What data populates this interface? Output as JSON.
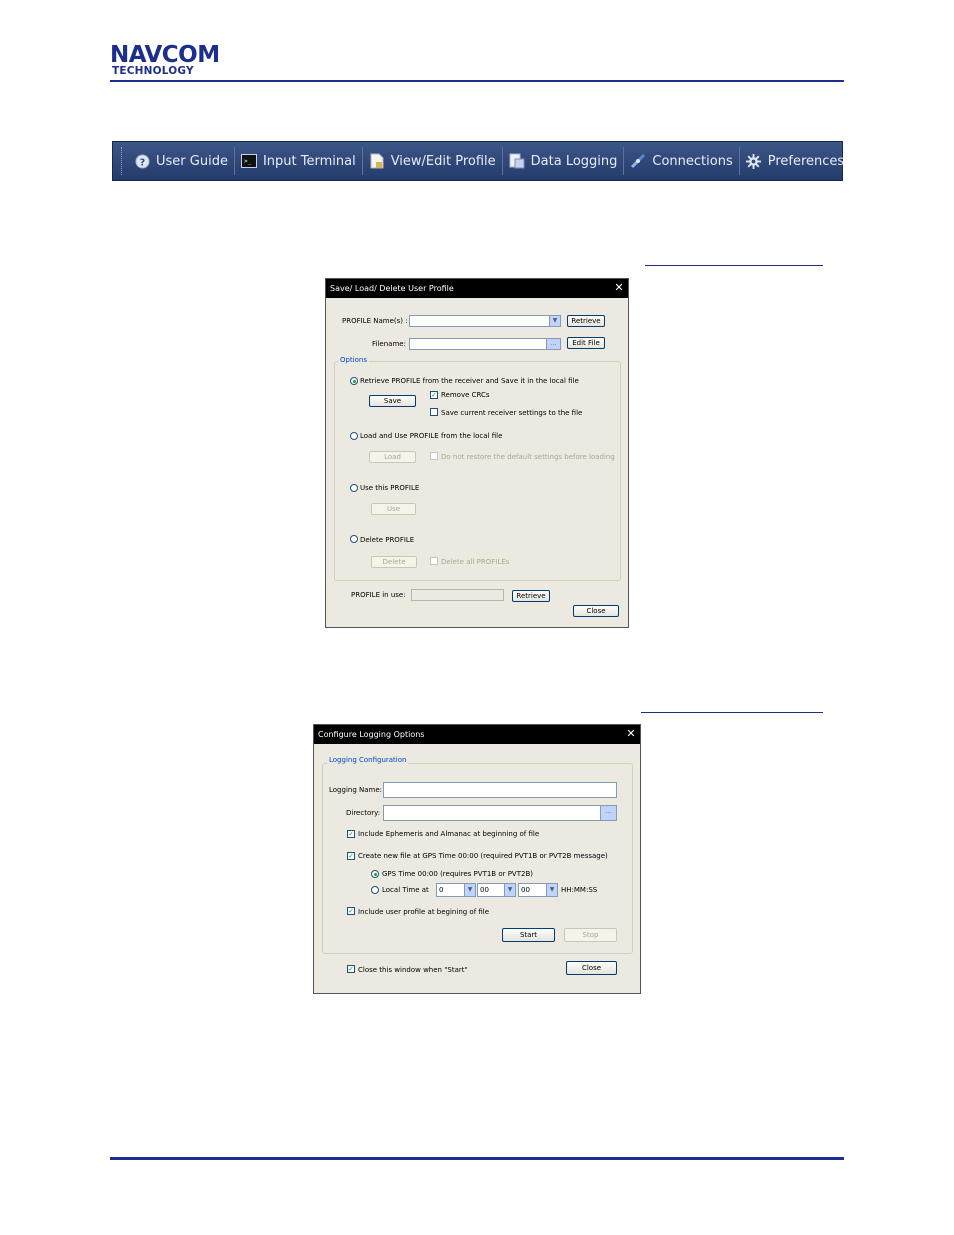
{
  "header": {
    "logo_line1": "NAVCOM",
    "logo_line2": "TECHNOLOGY"
  },
  "toolbar": {
    "items": [
      {
        "label": "User Guide",
        "icon": "help-circle-icon"
      },
      {
        "label": "Input Terminal",
        "icon": "terminal-icon"
      },
      {
        "label": "View/Edit Profile",
        "icon": "profile-document-icon"
      },
      {
        "label": "Data Logging",
        "icon": "data-logging-icon"
      },
      {
        "label": "Connections",
        "icon": "connections-icon"
      },
      {
        "label": "Preferences",
        "icon": "gear-icon"
      }
    ]
  },
  "profile_dialog": {
    "title": "Save/ Load/ Delete User Profile",
    "profile_name_label": "PROFILE Name(s) :",
    "profile_name_value": "",
    "retrieve_label": "Retrieve",
    "filename_label": "Filename:",
    "filename_value": "",
    "browse_label": "...",
    "edit_file_label": "Edit File",
    "options_label": "Options",
    "opt_retrieve": "Retrieve PROFILE from the receiver and Save it in the local file",
    "save_label": "Save",
    "remove_crcs": "Remove CRCs",
    "save_current": "Save current receiver settings to the file",
    "opt_load": "Load and Use PROFILE from the local file",
    "load_label": "Load",
    "no_restore": "Do not restore the default settings before loading",
    "opt_use": "Use this PROFILE",
    "use_label": "Use",
    "opt_delete": "Delete PROFILE",
    "delete_label": "Delete",
    "delete_all": "Delete all PROFILEs",
    "in_use_label": "PROFILE in use:",
    "in_use_value": "",
    "retrieve2_label": "Retrieve",
    "close_label": "Close"
  },
  "logging_dialog": {
    "title": "Configure Logging Options",
    "group_label": "Logging Configuration",
    "logging_name_label": "Logging Name:",
    "logging_name_value": "",
    "directory_label": "Directory:",
    "directory_value": "",
    "browse_label": "...",
    "include_ephemeris": "Include Ephemeris and Almanac at beginning of file",
    "create_new_file": "Create new file at GPS Time 00:00 (required PVT1B or PVT2B message)",
    "gps_time": "GPS Time 00:00 (requires PVT1B or PVT2B)",
    "local_time": "Local Time at",
    "hour": "0",
    "minute": "00",
    "second": "00",
    "time_format": "HH:MM:SS",
    "include_profile": "Include user profile at begining of file",
    "start_label": "Start",
    "stop_label": "Stop",
    "close_when_start": "Close this window when \"Start\"",
    "close_label": "Close"
  }
}
